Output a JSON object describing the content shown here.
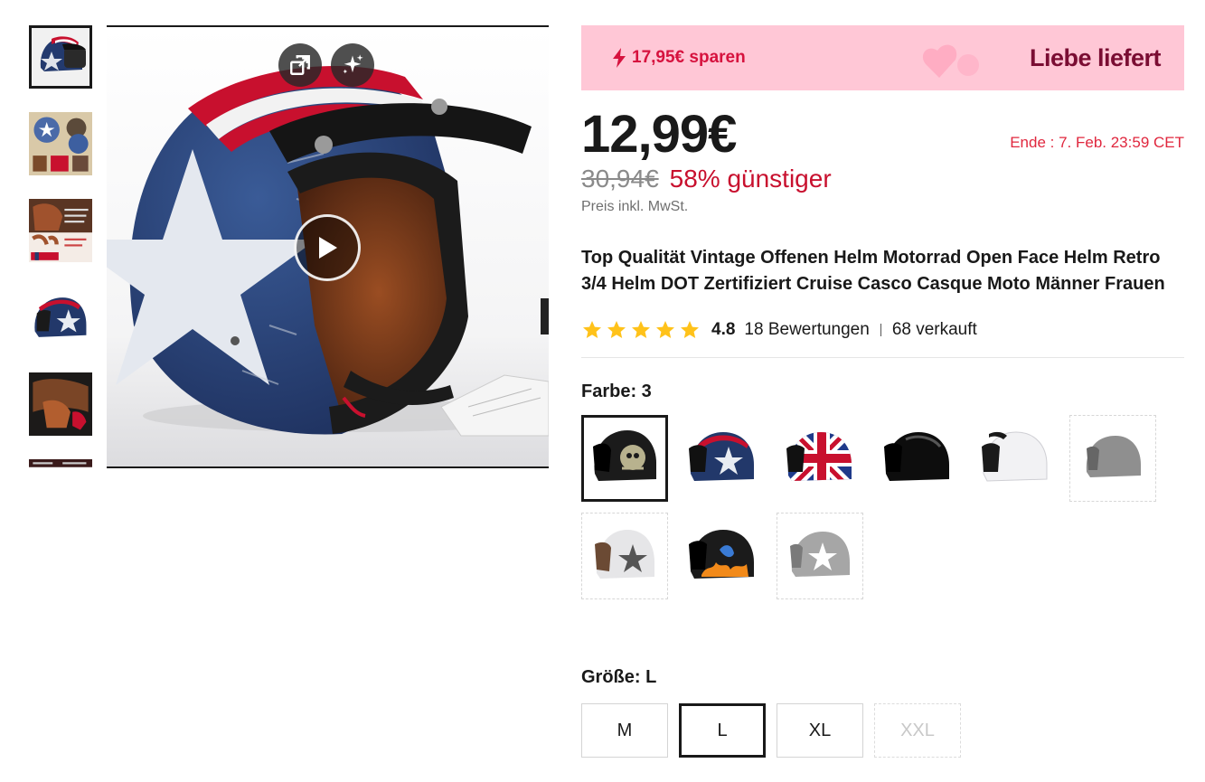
{
  "gallery": {
    "thumbnails": [
      {
        "name": "thumbnail-helmet-front"
      },
      {
        "name": "thumbnail-collage"
      },
      {
        "name": "thumbnail-interior-info"
      },
      {
        "name": "thumbnail-helmet-side"
      },
      {
        "name": "thumbnail-interior"
      },
      {
        "name": "thumbnail-partial"
      }
    ],
    "tools": [
      "expand-icon",
      "sparkle-icon"
    ],
    "video_play_icon": "play-icon"
  },
  "promo": {
    "save_text": "17,95€ sparen",
    "brand": "Liebe liefert",
    "icon": "lightning-icon"
  },
  "pricing": {
    "current": "12,99€",
    "original": "30,94€",
    "discount": "58% günstiger",
    "tax_note": "Preis inkl. MwSt.",
    "ende": "Ende :  7. Feb. 23:59 CET"
  },
  "product": {
    "title": "Top Qualität Vintage Offenen Helm Motorrad Open Face Helm Retro 3/4 Helm DOT Zertifiziert Cruise Casco Casque Moto Männer Frauen"
  },
  "rating": {
    "stars": 5,
    "score": "4.8",
    "reviews": "18 Bewertungen",
    "sold": "68 verkauft"
  },
  "color": {
    "label": "Farbe: 3",
    "options": [
      {
        "name": "black-skull"
      },
      {
        "name": "navy-star"
      },
      {
        "name": "union-jack"
      },
      {
        "name": "gloss-black"
      },
      {
        "name": "white"
      },
      {
        "name": "grey-unavailable"
      },
      {
        "name": "white-star-unavailable"
      },
      {
        "name": "black-flame"
      },
      {
        "name": "grey-star-unavailable"
      }
    ],
    "selected_index": 0
  },
  "size": {
    "label": "Größe: L",
    "options": [
      "M",
      "L",
      "XL",
      "XXL"
    ],
    "selected": "L",
    "disabled": [
      "XXL"
    ]
  },
  "colors": {
    "accent_red": "#c8102e",
    "promo_bg": "#ffc7d6",
    "brand": "#7a0d33",
    "star": "#ffc21a"
  }
}
